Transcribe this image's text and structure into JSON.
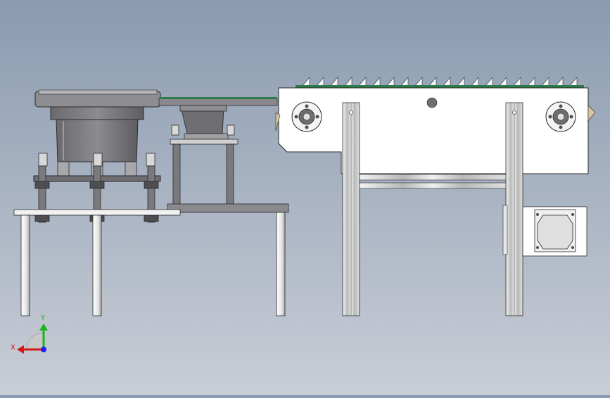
{
  "triad": {
    "x_label": "X",
    "y_label": "Y",
    "colors": {
      "x": "#d41818",
      "y": "#1bb31b",
      "z": "#1a1aff"
    }
  },
  "scene": {
    "colors": {
      "background_top": "#8a9bb0",
      "background_bottom": "#c9cdd6",
      "steel": "#e8e8e8",
      "dark_steel": "#6e6e72",
      "bowl": "#7a7a7e",
      "belt": "#2f7a4a",
      "outline": "#2a2a2a"
    },
    "icons": [
      "coordinate-triad-icon"
    ]
  }
}
